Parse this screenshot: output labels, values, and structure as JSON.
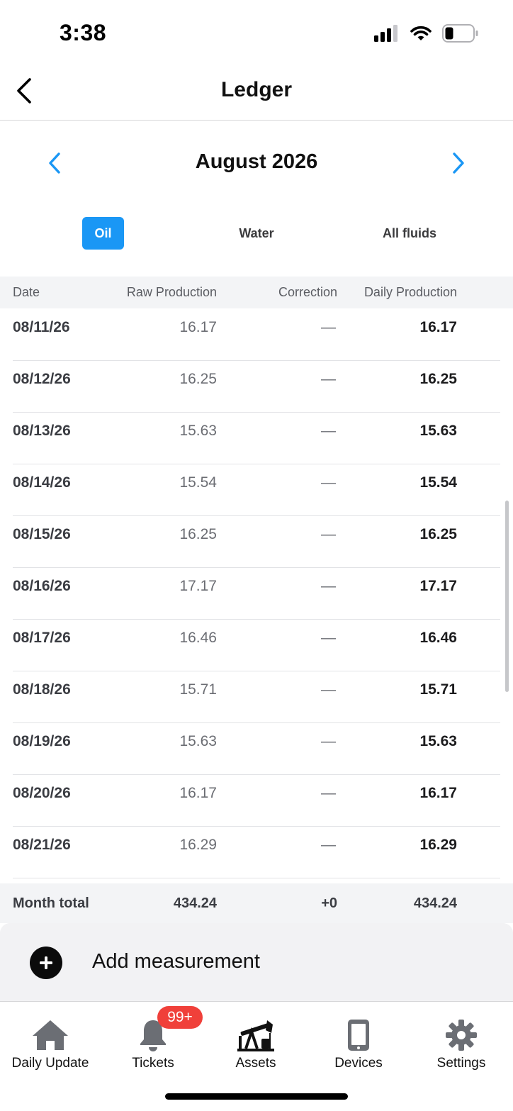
{
  "status_bar": {
    "time": "3:38"
  },
  "header": {
    "title": "Ledger"
  },
  "month_selector": {
    "label": "August 2026"
  },
  "fluid_tabs": [
    {
      "label": "Oil",
      "active": true
    },
    {
      "label": "Water",
      "active": false
    },
    {
      "label": "All fluids",
      "active": false
    }
  ],
  "table": {
    "columns": [
      "Date",
      "Raw Production",
      "Correction",
      "Daily Production"
    ],
    "rows": [
      {
        "date": "08/11/26",
        "raw": "16.17",
        "correction": "—",
        "daily": "16.17"
      },
      {
        "date": "08/12/26",
        "raw": "16.25",
        "correction": "—",
        "daily": "16.25"
      },
      {
        "date": "08/13/26",
        "raw": "15.63",
        "correction": "—",
        "daily": "15.63"
      },
      {
        "date": "08/14/26",
        "raw": "15.54",
        "correction": "—",
        "daily": "15.54"
      },
      {
        "date": "08/15/26",
        "raw": "16.25",
        "correction": "—",
        "daily": "16.25"
      },
      {
        "date": "08/16/26",
        "raw": "17.17",
        "correction": "—",
        "daily": "17.17"
      },
      {
        "date": "08/17/26",
        "raw": "16.46",
        "correction": "—",
        "daily": "16.46"
      },
      {
        "date": "08/18/26",
        "raw": "15.71",
        "correction": "—",
        "daily": "15.71"
      },
      {
        "date": "08/19/26",
        "raw": "15.63",
        "correction": "—",
        "daily": "15.63"
      },
      {
        "date": "08/20/26",
        "raw": "16.17",
        "correction": "—",
        "daily": "16.17"
      },
      {
        "date": "08/21/26",
        "raw": "16.29",
        "correction": "—",
        "daily": "16.29"
      }
    ],
    "total": {
      "label": "Month total",
      "raw": "434.24",
      "correction": "+0",
      "daily": "434.24"
    }
  },
  "add_measurement": {
    "label": "Add measurement",
    "icon": "plus-circle-icon"
  },
  "tab_bar": {
    "items": [
      {
        "label": "Daily Update",
        "icon": "home-icon"
      },
      {
        "label": "Tickets",
        "icon": "bell-icon",
        "badge": "99+"
      },
      {
        "label": "Assets",
        "icon": "pumpjack-icon"
      },
      {
        "label": "Devices",
        "icon": "phone-icon"
      },
      {
        "label": "Settings",
        "icon": "gear-icon"
      }
    ]
  },
  "colors": {
    "accent": "#1a97f5",
    "badge": "#f0403a",
    "icon_gray": "#6b6e74"
  }
}
